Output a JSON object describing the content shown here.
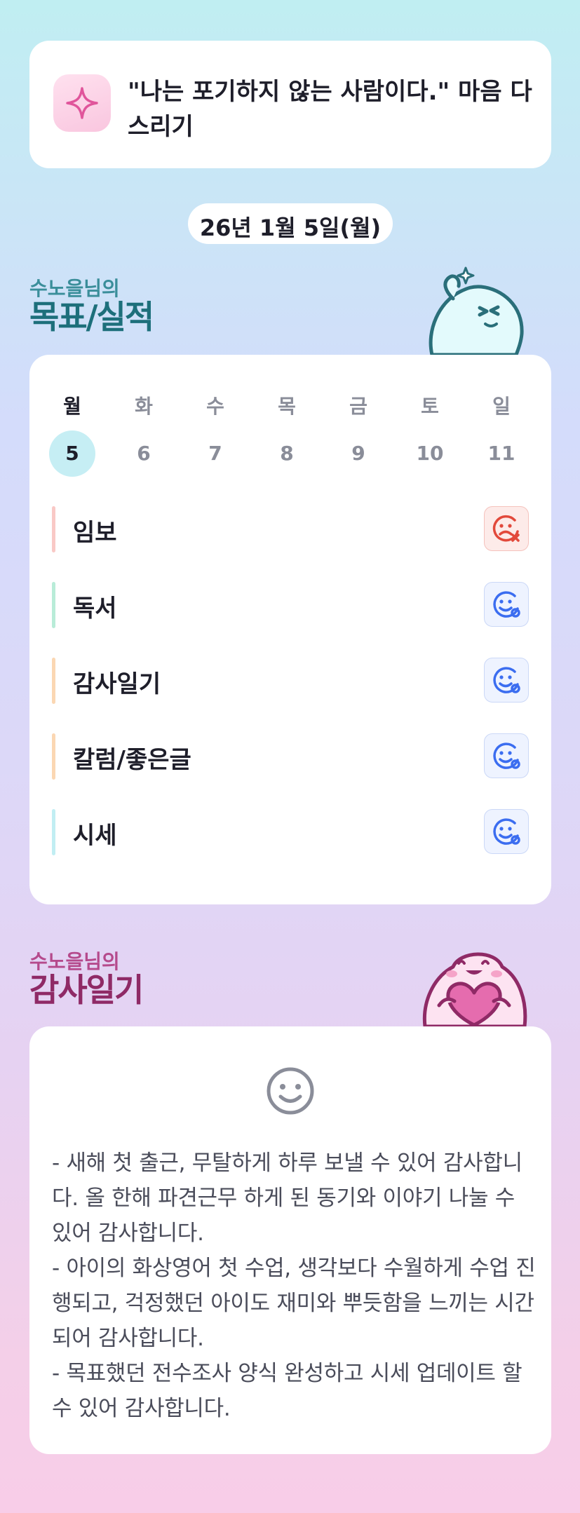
{
  "motto": {
    "text": "\"나는 포기하지 않는 사람이다.\" 마음 다스리기",
    "icon": "sparkle-icon"
  },
  "date": "26년 1월 5일(월)",
  "goals_section": {
    "owner": "수노을님의",
    "title": "목표/실적"
  },
  "week": {
    "days": [
      "월",
      "화",
      "수",
      "목",
      "금",
      "토",
      "일"
    ],
    "dates": [
      "5",
      "6",
      "7",
      "8",
      "9",
      "10",
      "11"
    ],
    "active_index": 0
  },
  "goals": [
    {
      "label": "임보",
      "status": "fail",
      "bar_color": "#f9c9c6"
    },
    {
      "label": "독서",
      "status": "done",
      "bar_color": "#b9ecd8"
    },
    {
      "label": "감사일기",
      "status": "done",
      "bar_color": "#fbd7b3"
    },
    {
      "label": "칼럼/좋은글",
      "status": "done",
      "bar_color": "#fbd7b3"
    },
    {
      "label": "시세",
      "status": "done",
      "bar_color": "#c1eef3"
    }
  ],
  "diary_section": {
    "owner": "수노을님의",
    "title": "감사일기",
    "mood_icon": "smile-face-icon",
    "text": "- 새해 첫 출근, 무탈하게 하루 보낼 수 있어 감사합니다.  올 한해 파견근무 하게 된 동기와 이야기 나눌 수 있어 감사합니다.\n- 아이의 화상영어 첫 수업, 생각보다 수월하게 수업 진행되고, 걱정했던 아이도 재미와 뿌듯함을 느끼는 시간되어 감사합니다.\n- 목표했던 전수조사 양식 완성하고 시세 업데이트 할 수 있어 감사합니다."
  },
  "colors": {
    "success_icon": "#3b6df0",
    "fail_icon": "#e2493b",
    "goals_title": "#1d6f7b",
    "diary_title": "#8f2a66"
  }
}
